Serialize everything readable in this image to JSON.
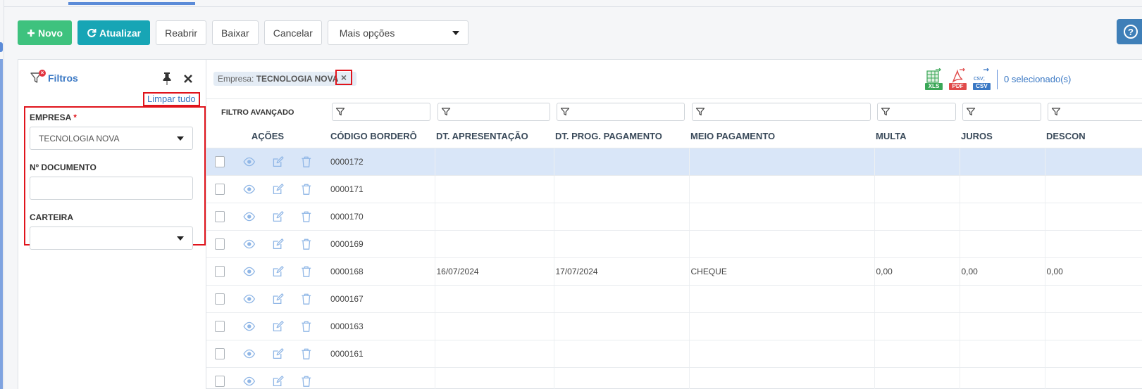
{
  "toolbar": {
    "new_label": "Novo",
    "refresh_label": "Atualizar",
    "reopen_label": "Reabrir",
    "settle_label": "Baixar",
    "cancel_label": "Cancelar",
    "more_options_label": "Mais opções"
  },
  "help": {
    "label": "?"
  },
  "filters": {
    "title": "Filtros",
    "clear_all": "Limpar tudo",
    "fields": {
      "company": {
        "label": "EMPRESA",
        "required_mark": "*",
        "value": "TECNOLOGIA NOVA"
      },
      "document": {
        "label": "Nº DOCUMENTO",
        "value": ""
      },
      "wallet": {
        "label": "CARTEIRA",
        "value": ""
      }
    }
  },
  "chip": {
    "key": "Empresa:",
    "value": "TECNOLOGIA NOVA",
    "close": "×"
  },
  "exports": {
    "xls": "XLS",
    "pdf": "PDF",
    "csv": "CSV",
    "csv_glyph": "csv;"
  },
  "selection": {
    "count_label": "0 selecionado(s)"
  },
  "advanced_filter": {
    "label": "FILTRO AVANÇADO"
  },
  "table": {
    "headers": {
      "actions": "AÇÕES",
      "code": "CÓDIGO BORDERÔ",
      "presentation_date": "DT. APRESENTAÇÃO",
      "scheduled_payment_date": "DT. PROG. PAGAMENTO",
      "payment_method": "MEIO PAGAMENTO",
      "fine": "MULTA",
      "interest": "JUROS",
      "discount": "DESCON"
    },
    "rows": [
      {
        "code": "0000172",
        "presentation_date": "",
        "scheduled_payment_date": "",
        "payment_method": "",
        "fine": "",
        "interest": "",
        "discount": "",
        "selected": true
      },
      {
        "code": "0000171",
        "presentation_date": "",
        "scheduled_payment_date": "",
        "payment_method": "",
        "fine": "",
        "interest": "",
        "discount": "",
        "selected": false
      },
      {
        "code": "0000170",
        "presentation_date": "",
        "scheduled_payment_date": "",
        "payment_method": "",
        "fine": "",
        "interest": "",
        "discount": "",
        "selected": false
      },
      {
        "code": "0000169",
        "presentation_date": "",
        "scheduled_payment_date": "",
        "payment_method": "",
        "fine": "",
        "interest": "",
        "discount": "",
        "selected": false
      },
      {
        "code": "0000168",
        "presentation_date": "16/07/2024",
        "scheduled_payment_date": "17/07/2024",
        "payment_method": "CHEQUE",
        "fine": "0,00",
        "interest": "0,00",
        "discount": "0,00",
        "selected": false
      },
      {
        "code": "0000167",
        "presentation_date": "",
        "scheduled_payment_date": "",
        "payment_method": "",
        "fine": "",
        "interest": "",
        "discount": "",
        "selected": false
      },
      {
        "code": "0000163",
        "presentation_date": "",
        "scheduled_payment_date": "",
        "payment_method": "",
        "fine": "",
        "interest": "",
        "discount": "",
        "selected": false
      },
      {
        "code": "0000161",
        "presentation_date": "",
        "scheduled_payment_date": "",
        "payment_method": "",
        "fine": "",
        "interest": "",
        "discount": "",
        "selected": false
      },
      {
        "code": "",
        "presentation_date": "",
        "scheduled_payment_date": "",
        "payment_method": "",
        "fine": "",
        "interest": "",
        "discount": "",
        "selected": false
      }
    ]
  },
  "colors": {
    "new_button": "#3ec27e",
    "refresh_button": "#17a5b5",
    "accent_blue": "#3a78c4",
    "highlight_red": "#e0141c",
    "selected_row": "#d9e6f8"
  },
  "icons": {
    "new": "plus-icon",
    "refresh": "refresh-icon",
    "filters": "filter-clear-icon",
    "pin": "pin-icon",
    "close": "close-icon",
    "view": "eye-icon",
    "edit": "edit-icon",
    "delete": "trash-icon",
    "column_filter": "funnel-icon"
  }
}
